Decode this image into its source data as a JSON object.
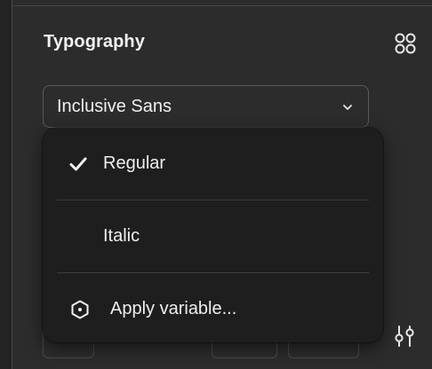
{
  "panel": {
    "title": "Typography"
  },
  "font_select": {
    "value": "Inclusive Sans"
  },
  "dropdown": {
    "items": [
      {
        "label": "Regular",
        "selected": true
      },
      {
        "label": "Italic",
        "selected": false
      },
      {
        "label": "Apply variable...",
        "icon": "variable-hexagon-icon"
      }
    ]
  },
  "icons": {
    "styles": "styles-grid-icon",
    "chevron": "chevron-down-icon",
    "check": "check-icon",
    "adjust": "adjust-sliders-icon"
  },
  "colors": {
    "panel_bg": "#2c2c2c",
    "menu_bg": "#1e1e1e",
    "text": "#efefef",
    "border": "#5a5a5a"
  }
}
